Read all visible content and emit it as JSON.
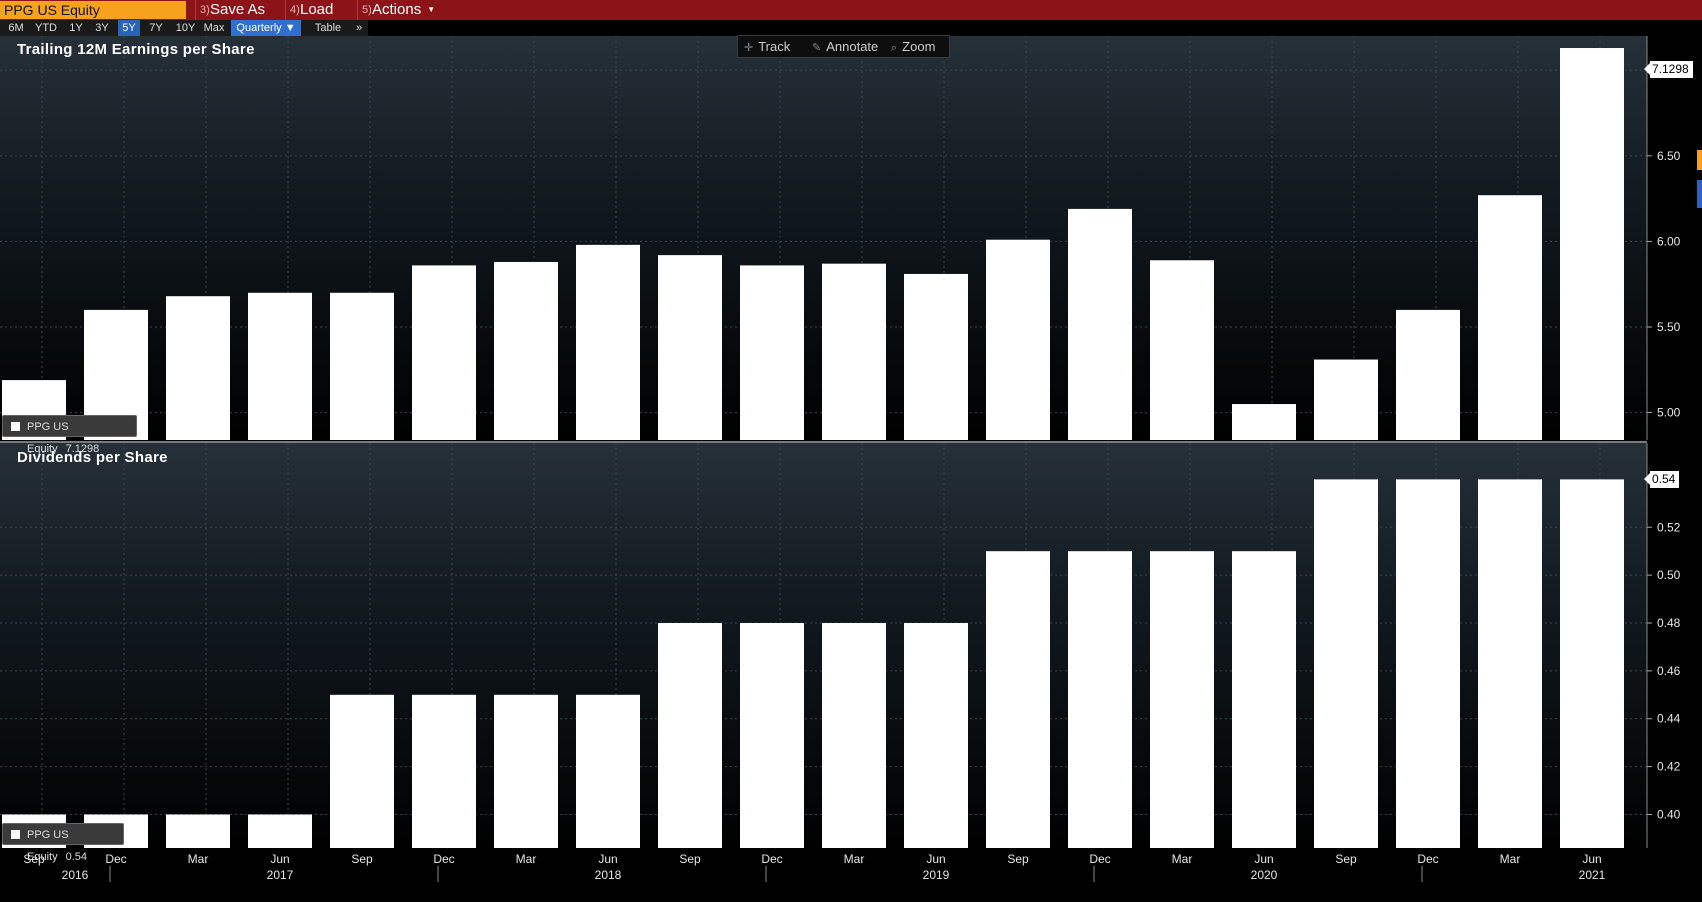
{
  "window": {
    "ticker": "PPG US Equity",
    "save_as": "Save As",
    "load": "Load",
    "actions": "Actions",
    "num_save": "3)",
    "num_load": "4)",
    "num_actions": "5)"
  },
  "ranges": [
    "6M",
    "YTD",
    "1Y",
    "3Y",
    "5Y",
    "7Y",
    "10Y",
    "Max"
  ],
  "active_range": "5Y",
  "frequency": "Quarterly ▼",
  "table_label": "Table",
  "more_label": "»",
  "tools": {
    "track": "Track",
    "annotate": "Annotate",
    "zoom": "Zoom"
  },
  "colors": {
    "bars": "#ffffff",
    "accent": "#f7a21e",
    "toolbar": "#8c1419",
    "active": "#2a63b8"
  },
  "chart_data": [
    {
      "type": "bar",
      "title": "Trailing 12M Earnings per Share",
      "categories": [
        "2016-09",
        "2016-12",
        "2017-03",
        "2017-06",
        "2017-09",
        "2017-12",
        "2018-03",
        "2018-06",
        "2018-09",
        "2018-12",
        "2019-03",
        "2019-06",
        "2019-09",
        "2019-12",
        "2020-03",
        "2020-06",
        "2020-09",
        "2020-12",
        "2021-03",
        "2021-06"
      ],
      "values": [
        5.19,
        5.6,
        5.68,
        5.7,
        5.7,
        5.86,
        5.88,
        5.98,
        5.92,
        5.86,
        5.87,
        5.81,
        6.01,
        6.19,
        5.89,
        5.05,
        5.31,
        5.6,
        6.27,
        7.1298
      ],
      "ylim": [
        4.84,
        7.2
      ],
      "yticks": [
        "5.00",
        "5.50",
        "6.00",
        "6.50",
        "7.00"
      ],
      "ytick_values": [
        5.0,
        5.5,
        6.0,
        6.5,
        7.0
      ],
      "legend": "PPG US Equity",
      "last_value": "7.1298"
    },
    {
      "type": "bar",
      "title": "Dividends per Share",
      "categories": [
        "2016-09",
        "2016-12",
        "2017-03",
        "2017-06",
        "2017-09",
        "2017-12",
        "2018-03",
        "2018-06",
        "2018-09",
        "2018-12",
        "2019-03",
        "2019-06",
        "2019-09",
        "2019-12",
        "2020-03",
        "2020-06",
        "2020-09",
        "2020-12",
        "2021-03",
        "2021-06"
      ],
      "values": [
        0.4,
        0.4,
        0.4,
        0.4,
        0.45,
        0.45,
        0.45,
        0.45,
        0.48,
        0.48,
        0.48,
        0.48,
        0.51,
        0.51,
        0.51,
        0.51,
        0.54,
        0.54,
        0.54,
        0.54
      ],
      "ylim": [
        0.386,
        0.5552
      ],
      "yticks": [
        "0.40",
        "0.42",
        "0.44",
        "0.46",
        "0.48",
        "0.50",
        "0.52"
      ],
      "ytick_values": [
        0.4,
        0.42,
        0.44,
        0.46,
        0.48,
        0.5,
        0.52
      ],
      "legend": "PPG US Equity",
      "last_value": "0.54"
    }
  ],
  "x_axis": {
    "month_labels": [
      "Sep",
      "Dec",
      "Mar",
      "Jun",
      "Sep",
      "Dec",
      "Mar",
      "Jun",
      "Sep",
      "Dec",
      "Mar",
      "Jun",
      "Sep",
      "Dec",
      "Mar",
      "Jun",
      "Sep",
      "Dec",
      "Mar",
      "Jun"
    ],
    "years": [
      {
        "label": "2016",
        "index": 0.5
      },
      {
        "label": "2017",
        "index": 3
      },
      {
        "label": "2018",
        "index": 7
      },
      {
        "label": "2019",
        "index": 11
      },
      {
        "label": "2020",
        "index": 15
      },
      {
        "label": "2021",
        "index": 19
      }
    ]
  }
}
